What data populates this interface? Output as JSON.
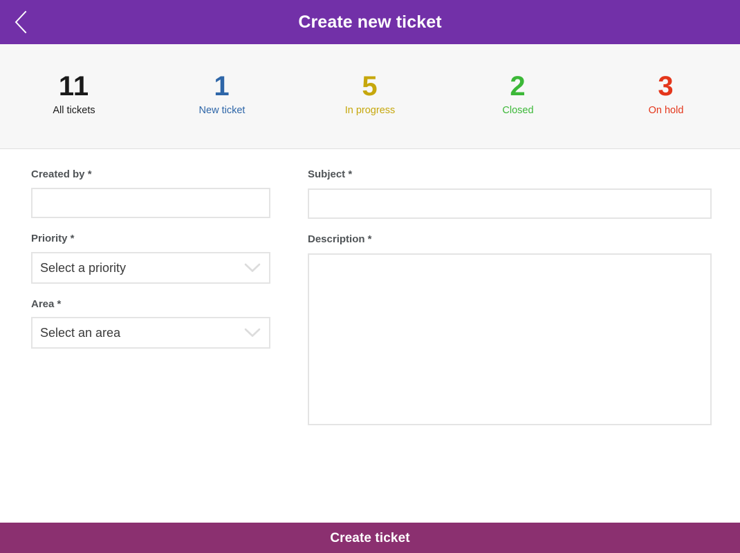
{
  "header": {
    "title": "Create new ticket",
    "back_icon": "chevron-left-icon",
    "background": "#7230A8",
    "title_color": "#FFFFFF"
  },
  "stats": {
    "items": [
      {
        "value": "11",
        "label": "All tickets",
        "color": "#1A1A1A"
      },
      {
        "value": "1",
        "label": "New ticket",
        "color": "#2E66A8"
      },
      {
        "value": "5",
        "label": "In progress",
        "color": "#C6A70C"
      },
      {
        "value": "2",
        "label": "Closed",
        "color": "#3CB838"
      },
      {
        "value": "3",
        "label": "On hold",
        "color": "#E4361B"
      }
    ],
    "background": "#F7F7F7"
  },
  "form": {
    "left": {
      "created_by": {
        "label": "Created by *",
        "value": "",
        "placeholder": ""
      },
      "priority": {
        "label": "Priority *",
        "value": "Select a priority",
        "chevron_icon": "chevron-down-icon"
      },
      "area": {
        "label": "Area *",
        "value": "Select an area",
        "chevron_icon": "chevron-down-icon"
      }
    },
    "right": {
      "subject": {
        "label": "Subject *",
        "value": "",
        "placeholder": ""
      },
      "description": {
        "label": "Description *",
        "value": "",
        "placeholder": ""
      }
    }
  },
  "footer": {
    "submit_label": "Create ticket",
    "background": "#8B3070",
    "text_color": "#FFFFFF"
  }
}
